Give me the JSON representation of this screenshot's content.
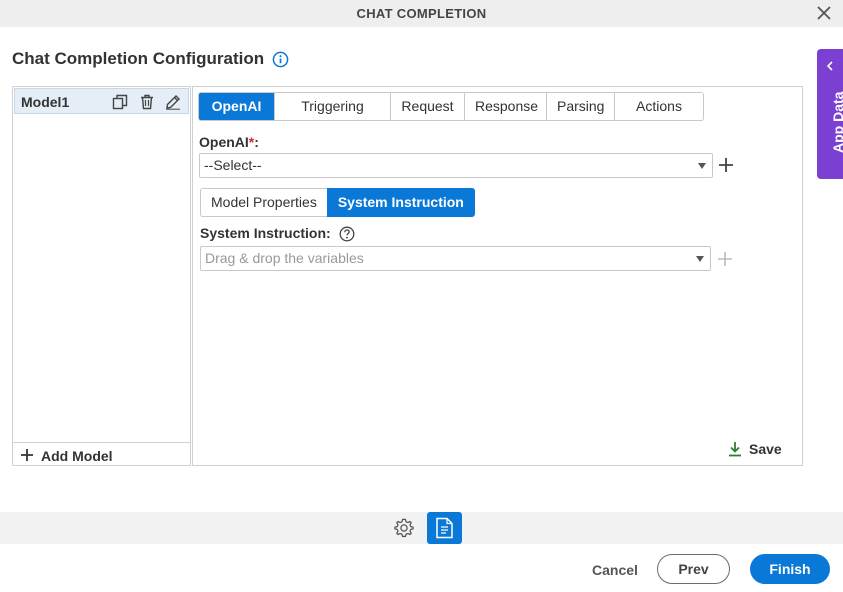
{
  "window": {
    "title": "CHAT COMPLETION"
  },
  "page": {
    "heading": "Chat Completion Configuration"
  },
  "side_tab": {
    "label": "App Data"
  },
  "models": {
    "items": [
      {
        "name": "Model1"
      }
    ],
    "add_label": "Add Model"
  },
  "tabs": [
    {
      "label": "OpenAI",
      "active": true
    },
    {
      "label": "Triggering Event",
      "active": false
    },
    {
      "label": "Request",
      "active": false
    },
    {
      "label": "Response",
      "active": false
    },
    {
      "label": "Parsing",
      "active": false
    },
    {
      "label": "Actions",
      "active": false
    }
  ],
  "openai": {
    "label": "OpenAI",
    "required_mark": "*",
    "label_suffix": ":",
    "selected": "--Select--"
  },
  "subtabs": [
    {
      "label": "Model Properties",
      "active": false
    },
    {
      "label": "System Instruction",
      "active": true
    }
  ],
  "system_instruction": {
    "label": "System Instruction:",
    "placeholder": "Drag & drop the variables"
  },
  "save_label": "Save",
  "footer": {
    "cancel_label": "Cancel",
    "prev_label": "Prev",
    "finish_label": "Finish"
  },
  "colors": {
    "accent": "#0a78d7",
    "side_tab": "#7b3fd1",
    "required": "#d9262c",
    "save_icon": "#2e7d32"
  },
  "icons": {
    "close": "close-icon",
    "info": "info-icon",
    "duplicate": "duplicate-icon",
    "delete": "trash-icon",
    "edit": "pencil-icon",
    "add": "plus-icon",
    "help": "help-icon",
    "save": "download-icon",
    "settings": "gear-icon",
    "document": "document-icon"
  }
}
